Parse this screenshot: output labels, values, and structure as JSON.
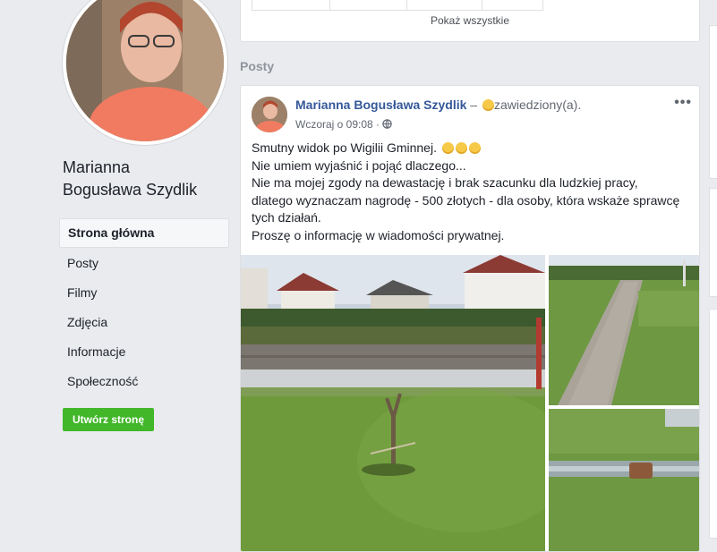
{
  "profile": {
    "name_line1": "Marianna",
    "name_line2": "Bogusława Szydlik"
  },
  "nav": {
    "items": [
      {
        "label": "Strona główna",
        "active": true
      },
      {
        "label": "Posty"
      },
      {
        "label": "Filmy"
      },
      {
        "label": "Zdjęcia"
      },
      {
        "label": "Informacje"
      },
      {
        "label": "Społeczność"
      }
    ],
    "create_page": "Utwórz stronę"
  },
  "top_card": {
    "show_all": "Pokaż wszystkie"
  },
  "posts_section": {
    "title": "Posty"
  },
  "post": {
    "author": "Marianna Bogusława Szydlik",
    "dash": " – ",
    "feeling": "zawiedziony(a).",
    "timestamp": "Wczoraj o 09:08 ·",
    "privacy_icon": "globe-icon",
    "more_icon": "more-options-icon",
    "more_label": "•••",
    "text_line1": "Smutny widok po Wigilii Gminnej.",
    "text_line2": "Nie umiem wyjaśnić i pojąć dlaczego...",
    "text_line3": "Nie ma mojej zgody na dewastację i brak szacunku dla ludzkiej pracy, dlatego wyznaczam nagrodę - 500 złotych - dla osoby, która wskaże sprawcę tych działań.",
    "text_line4": "Proszę o informację w wiadomości prywatnej."
  },
  "colors": {
    "background": "#e9ebee",
    "link": "#365899",
    "create_button": "#42b72a"
  }
}
